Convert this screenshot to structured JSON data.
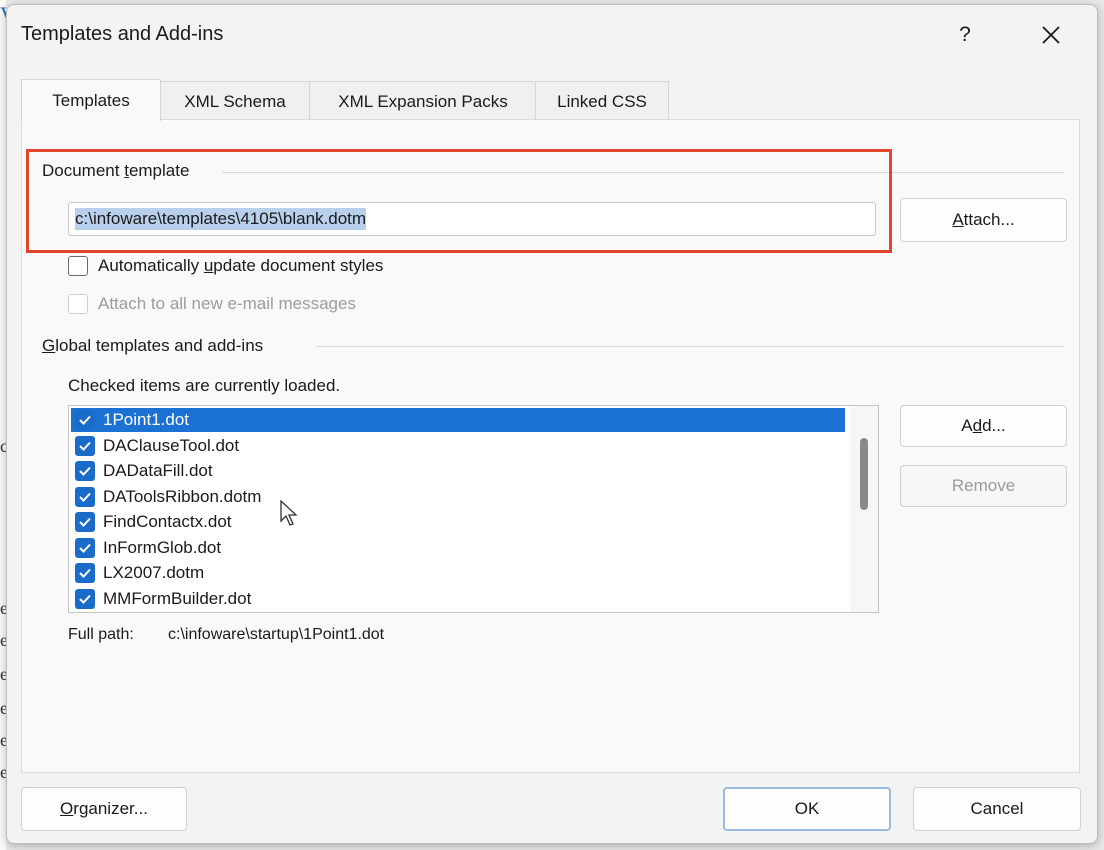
{
  "background": {
    "fragment_letters": [
      "c",
      "e",
      "e",
      "e",
      "e",
      "e",
      "e"
    ],
    "corner_mark": "V"
  },
  "dialog": {
    "title": "Templates and Add-ins",
    "help_label": "?",
    "close_label": "✕",
    "tabs": [
      {
        "label": "Templates",
        "active": true
      },
      {
        "label": "XML Schema",
        "active": false
      },
      {
        "label": "XML Expansion Packs",
        "active": false
      },
      {
        "label": "Linked CSS",
        "active": false
      }
    ],
    "document_template": {
      "section_title_pre": "Document ",
      "section_title_accel": "t",
      "section_title_post": "emplate",
      "path_value": "c:\\infoware\\templates\\4105\\blank.dotm",
      "attach_pre": "",
      "attach_accel": "A",
      "attach_post": "ttach...",
      "auto_update_pre": "Automatically ",
      "auto_update_accel": "u",
      "auto_update_post": "pdate document styles",
      "auto_update_checked": false,
      "attach_email_label": "Attach to all new e-mail messages",
      "attach_email_checked": false,
      "attach_email_enabled": false
    },
    "global": {
      "section_title_pre": "",
      "section_title_accel": "G",
      "section_title_post": "lobal templates and add-ins",
      "hint": "Checked items are currently loaded.",
      "items": [
        {
          "label": "1Point1.dot",
          "checked": true,
          "selected": true
        },
        {
          "label": "DAClauseTool.dot",
          "checked": true,
          "selected": false
        },
        {
          "label": "DADataFill.dot",
          "checked": true,
          "selected": false
        },
        {
          "label": "DAToolsRibbon.dotm",
          "checked": true,
          "selected": false
        },
        {
          "label": "FindContactx.dot",
          "checked": true,
          "selected": false
        },
        {
          "label": "InFormGlob.dot",
          "checked": true,
          "selected": false
        },
        {
          "label": "LX2007.dotm",
          "checked": true,
          "selected": false
        },
        {
          "label": "MMFormBuilder.dot",
          "checked": true,
          "selected": false
        }
      ],
      "add_pre": "A",
      "add_accel": "d",
      "add_post": "d...",
      "remove_label": "Remove",
      "full_path_label": "Full path:",
      "full_path_value": "c:\\infoware\\startup\\1Point1.dot"
    },
    "footer": {
      "organizer_pre": "",
      "organizer_accel": "O",
      "organizer_post": "rganizer...",
      "ok_label": "OK",
      "cancel_label": "Cancel"
    },
    "colors": {
      "accent": "#1b72d4",
      "highlight_box": "#e2472d"
    }
  }
}
